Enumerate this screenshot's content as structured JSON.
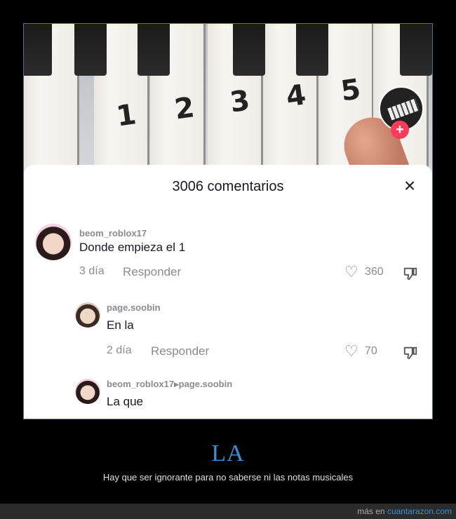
{
  "video": {
    "key_numbers": [
      "1",
      "2",
      "3",
      "4",
      "5"
    ],
    "follow_badge": "+"
  },
  "comments_panel": {
    "title": "3006 comentarios",
    "close_label": "×",
    "comments": [
      {
        "username": "beom_roblox17",
        "text": "Donde empieza el 1",
        "age": "3 día",
        "reply_label": "Responder",
        "likes": "360"
      },
      {
        "username": "page.soobin",
        "text": "En la",
        "age": "2 día",
        "reply_label": "Responder",
        "likes": "70"
      },
      {
        "username": "beom_roblox17▸page.soobin",
        "text": "La que"
      }
    ]
  },
  "caption": {
    "title": "LA",
    "subtitle": "Hay que ser ignorante para no saberse ni las notas musicales"
  },
  "footer": {
    "prefix": "más en ",
    "link_text": "cuantarazon.com"
  },
  "colors": {
    "accent": "#3a8fd8",
    "tiktok_red": "#ff3b5c"
  },
  "icons": [
    "heart-icon",
    "dislike-icon",
    "close-icon",
    "plus-icon"
  ]
}
